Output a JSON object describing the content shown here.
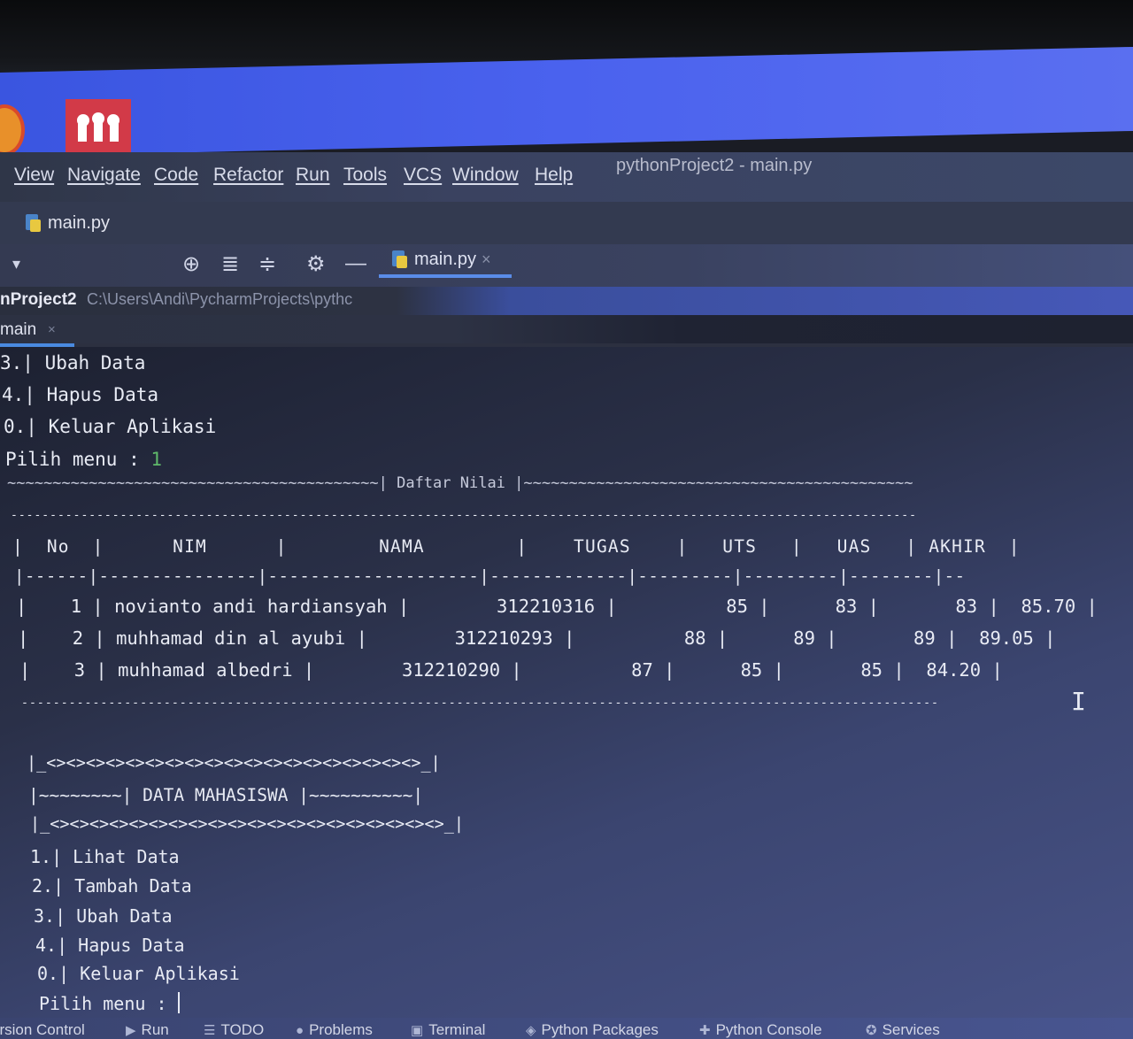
{
  "menubar": {
    "items": [
      "View",
      "Navigate",
      "Code",
      "Refactor",
      "Run",
      "Tools",
      "VCS",
      "Window",
      "Help"
    ],
    "window_title": "pythonProject2 - main.py"
  },
  "file_crumb": "main.py",
  "editor_tab": {
    "label": "main.py",
    "close": "×"
  },
  "project": {
    "name": "nProject2",
    "path": "C:\\Users\\Andi\\PycharmProjects\\pythc"
  },
  "run_tab": {
    "label": "main",
    "close": "×"
  },
  "console": {
    "top_menu": [
      "3.| Ubah Data",
      "4.| Hapus Data",
      "0.| Keluar Aplikasi"
    ],
    "prompt1_label": "Pilih menu : ",
    "prompt1_value": "1",
    "daftar_title": "~~~~~~~~~~~~~~~~~~~~~~~~~~~~~~~~~~~~~~~~~| Daftar Nilai |~~~~~~~~~~~~~~~~~~~~~~~~~~~~~~~~~~~~~~~~~~~",
    "rule_top": "--------------------------------------------------------------------------------------------------------------------",
    "header_line": "|  No  |      NIM      |        NAMA        |    TUGAS    |   UTS   |   UAS   | AKHIR  |",
    "header_sep": "|------|---------------|--------------------|-------------|---------|---------|--------|--",
    "rows": [
      "|    1 | novianto andi hardiansyah |        312210316 |          85 |      83 |       83 |  85.70 |",
      "|    2 | muhhamad din al ayubi |        312210293 |          88 |      89 |       89 |  89.05 |",
      "|    3 | muhhamad albedri |        312210290 |          87 |      85 |       85 |  84.20 |"
    ],
    "rule_bottom": "--------------------------------------------------------------------------------------------------------------------",
    "box_top": "|_<><><><><><><><><><><><><><><><><><><>_|",
    "box_title": "|~~~~~~~~| DATA MAHASISWA |~~~~~~~~~~|",
    "box_bottom": "|_<><><><><><><><><><><><><><><><><><><><>_|",
    "menu": [
      "1.| Lihat Data",
      "2.| Tambah Data",
      "3.| Ubah Data",
      "4.| Hapus Data",
      "0.| Keluar Aplikasi"
    ],
    "prompt2_label": "Pilih menu : "
  },
  "bottom_tools": [
    {
      "label": "ersion Control",
      "icon": "vcs-icon"
    },
    {
      "label": "Run",
      "icon": "run-icon"
    },
    {
      "label": "TODO",
      "icon": "todo-icon"
    },
    {
      "label": "Problems",
      "icon": "problems-icon"
    },
    {
      "label": "Terminal",
      "icon": "terminal-icon"
    },
    {
      "label": "Python Packages",
      "icon": "packages-icon"
    },
    {
      "label": "Python Console",
      "icon": "python-console-icon"
    },
    {
      "label": "Services",
      "icon": "services-icon"
    }
  ]
}
